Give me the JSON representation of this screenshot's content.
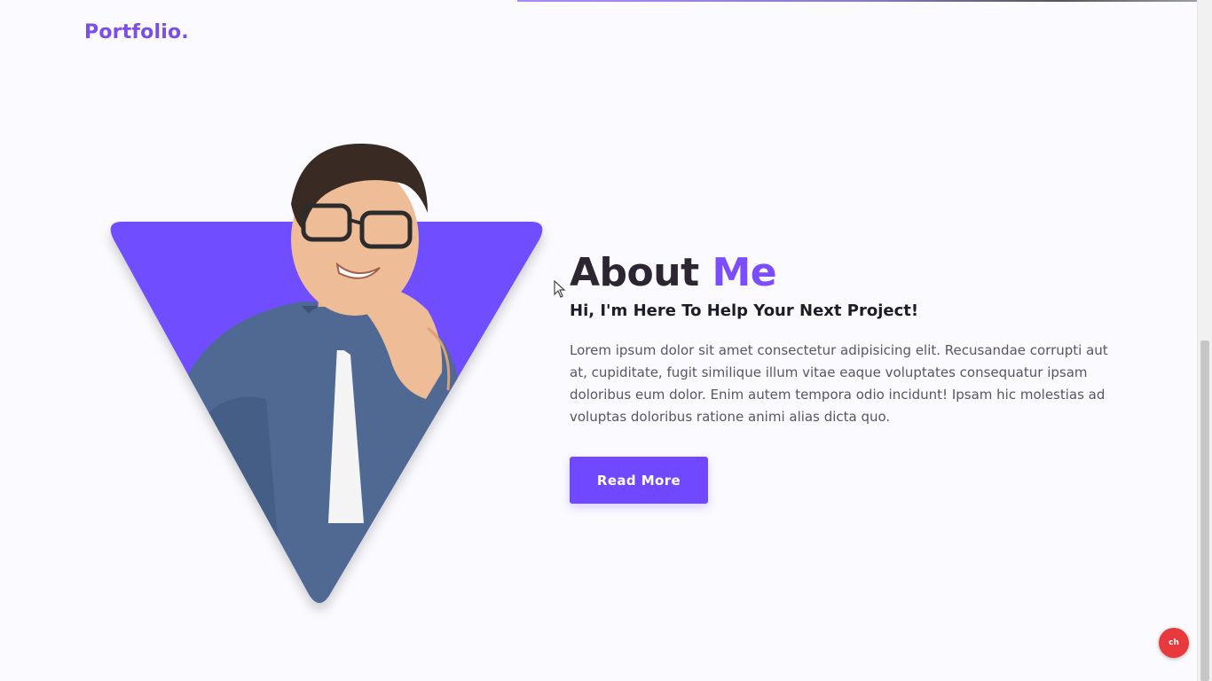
{
  "brand": {
    "logo_text": "Portfolio."
  },
  "about": {
    "title_word1": "About",
    "title_word2": "Me",
    "subtitle": "Hi, I'm Here To Help Your Next Project!",
    "body": "Lorem ipsum dolor sit amet consectetur adipisicing elit. Recusandae corrupti aut at, cupiditate, fugit similique illum vitae eaque voluptates consequatur ipsam doloribus eum dolor. Enim autem tempora odio incidunt! Ipsam hic molestias ad voluptas doloribus ratione animi alias dicta quo.",
    "button_label": "Read More"
  },
  "badge": {
    "text": "ch"
  },
  "colors": {
    "accent": "#7048ff",
    "logo": "#7b4dea",
    "heading": "#2b2631",
    "body_text": "#5a5466",
    "background": "#fbfafe"
  },
  "icons": {
    "cursor": "mouse-pointer-icon",
    "badge": "subscribe-badge-icon"
  }
}
